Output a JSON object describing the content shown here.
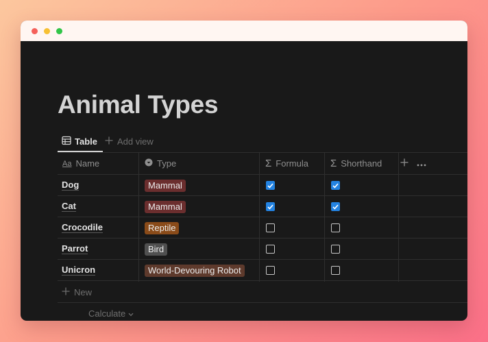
{
  "page": {
    "title": "Animal Types"
  },
  "views": {
    "active_label": "Table",
    "add_label": "Add view"
  },
  "table": {
    "columns": [
      {
        "label": "Name",
        "icon": "text-property-icon"
      },
      {
        "label": "Type",
        "icon": "select-property-icon"
      },
      {
        "label": "Formula",
        "icon": "sigma-icon"
      },
      {
        "label": "Shorthand",
        "icon": "sigma-icon"
      }
    ],
    "rows": [
      {
        "name": "Dog",
        "type": "Mammal",
        "type_color": "#6b2e2e",
        "formula": true,
        "shorthand": true
      },
      {
        "name": "Cat",
        "type": "Mammal",
        "type_color": "#6b2e2e",
        "formula": true,
        "shorthand": true
      },
      {
        "name": "Crocodile",
        "type": "Reptile",
        "type_color": "#8a4b19",
        "formula": false,
        "shorthand": false
      },
      {
        "name": "Parrot",
        "type": "Bird",
        "type_color": "#505050",
        "formula": false,
        "shorthand": false
      },
      {
        "name": "Unicron",
        "type": "World-Devouring Robot",
        "type_color": "#5e3a2c",
        "formula": false,
        "shorthand": false
      }
    ],
    "new_label": "New",
    "calculate_label": "Calculate"
  },
  "colors": {
    "accent": "#2383e2",
    "background": "#191919",
    "titlebar": "#fff6f2"
  }
}
